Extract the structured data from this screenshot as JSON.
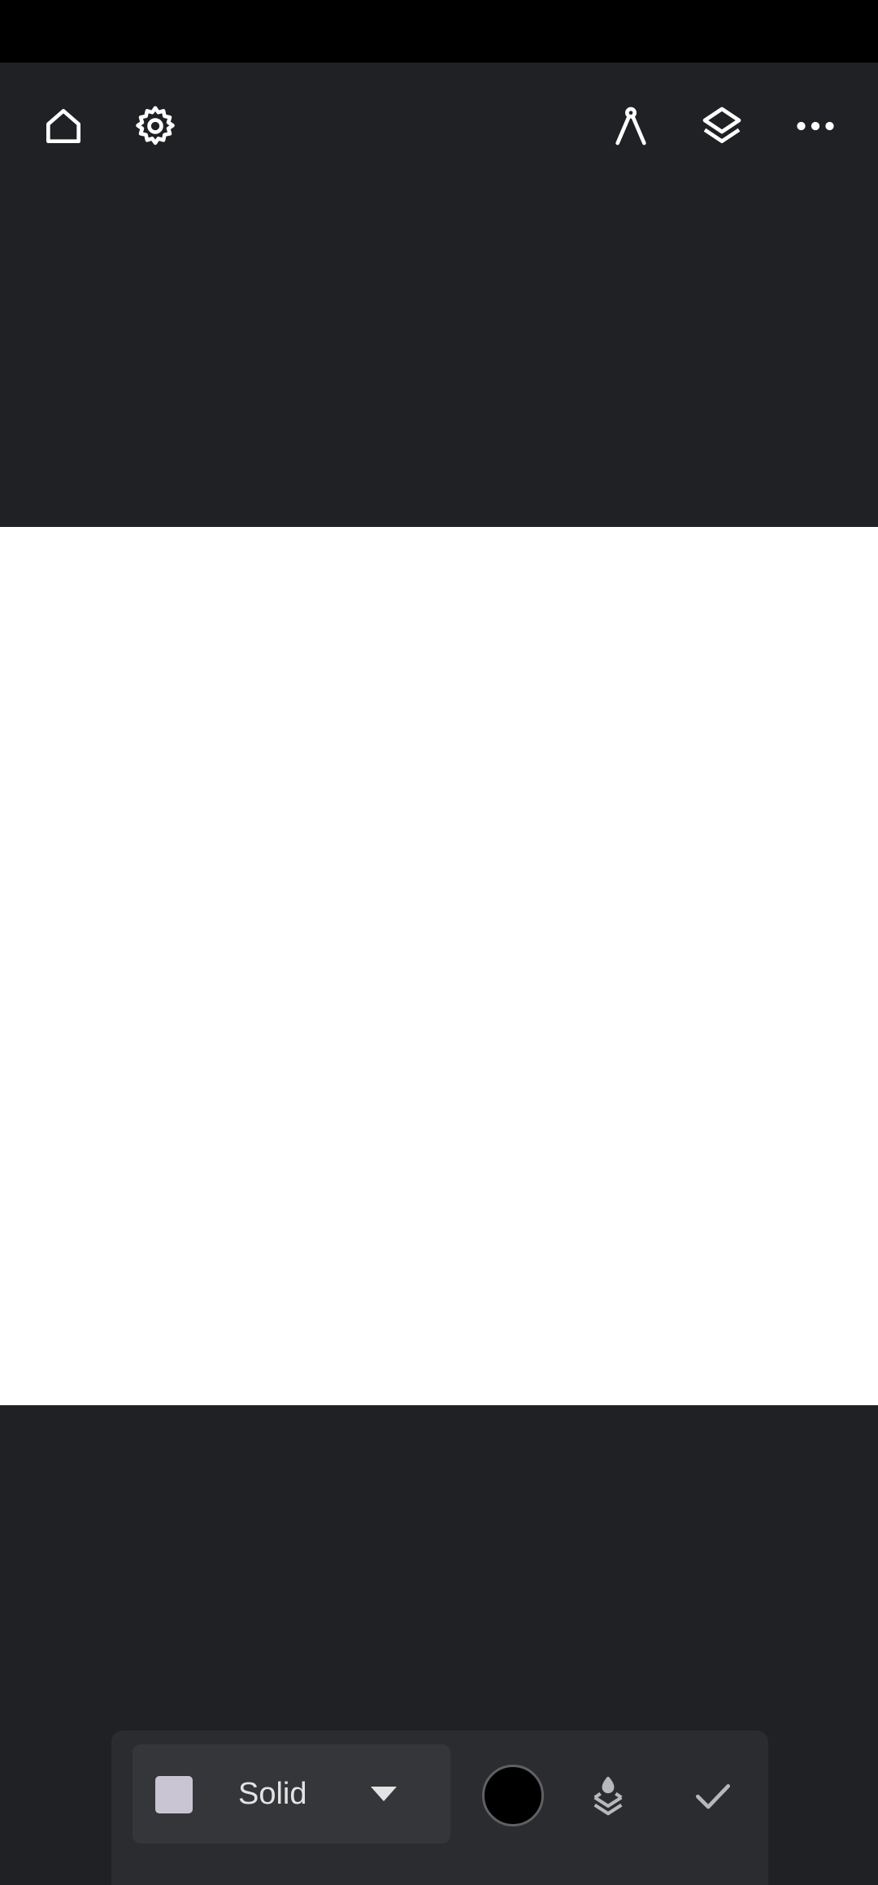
{
  "toolbar": {
    "icons": {
      "home": "home-icon",
      "settings": "gear-icon",
      "guides": "compass-icon",
      "layers": "layers-icon",
      "more": "more-horizontal-icon"
    }
  },
  "fill_panel": {
    "fill_type": "Solid",
    "swatch_color": "#c9c5d3",
    "stroke_color": "#000000",
    "icons": {
      "dropdown": "chevron-down-icon",
      "fill_layer": "layer-fill-icon",
      "confirm": "check-icon"
    }
  },
  "colors": {
    "toolbar_bg": "#202124",
    "canvas_bg": "#ffffff",
    "panel_bg": "#2b2c30"
  }
}
